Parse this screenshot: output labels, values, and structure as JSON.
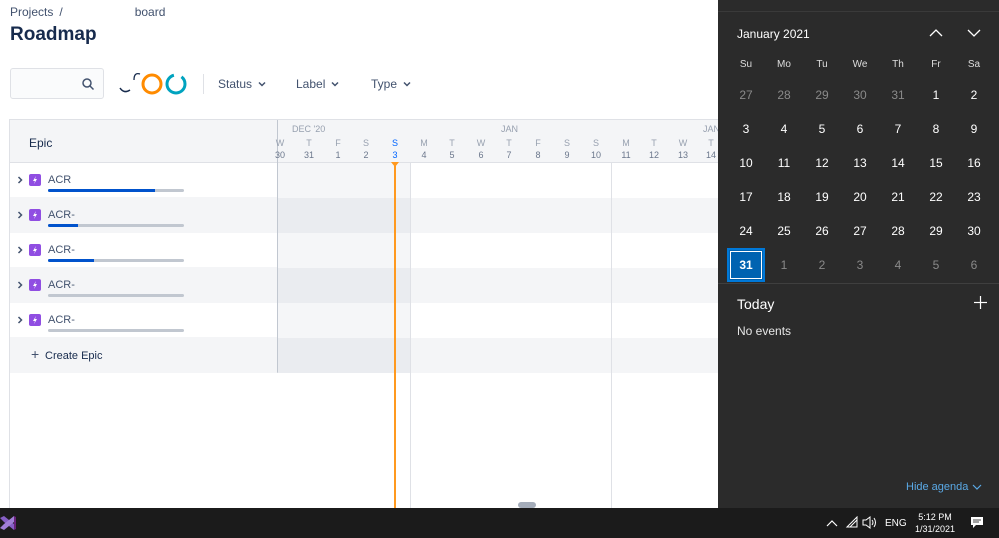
{
  "breadcrumb": {
    "root": "Projects",
    "separator": "/",
    "board": "board"
  },
  "page": {
    "title": "Roadmap"
  },
  "filters": {
    "status": "Status",
    "label": "Label",
    "type": "Type"
  },
  "search": {
    "placeholder": ""
  },
  "epics": {
    "header": "Epic",
    "items": [
      {
        "key": "ACR",
        "progress": 0.79
      },
      {
        "key": "ACR-",
        "progress": 0.22
      },
      {
        "key": "ACR-",
        "progress": 0.34
      },
      {
        "key": "ACR-",
        "progress": 0.0
      },
      {
        "key": "ACR-",
        "progress": 0.0
      }
    ],
    "create_label": "Create Epic"
  },
  "timeline": {
    "months": [
      "DEC '20",
      "JAN",
      "JAN"
    ],
    "day_letters": [
      "W",
      "T",
      "F",
      "S",
      "S",
      "M",
      "T",
      "W",
      "T",
      "F",
      "S",
      "S",
      "M",
      "T",
      "W",
      "T"
    ],
    "day_numbers": [
      "30",
      "31",
      "1",
      "2",
      "3",
      "4",
      "5",
      "6",
      "7",
      "8",
      "9",
      "10",
      "11",
      "12",
      "13",
      "14"
    ]
  },
  "calendar": {
    "title": "January 2021",
    "weekdays": [
      "Su",
      "Mo",
      "Tu",
      "We",
      "Th",
      "Fr",
      "Sa"
    ],
    "weeks": [
      [
        "27",
        "28",
        "29",
        "30",
        "31",
        "1",
        "2"
      ],
      [
        "3",
        "4",
        "5",
        "6",
        "7",
        "8",
        "9"
      ],
      [
        "10",
        "11",
        "12",
        "13",
        "14",
        "15",
        "16"
      ],
      [
        "17",
        "18",
        "19",
        "20",
        "21",
        "22",
        "23"
      ],
      [
        "24",
        "25",
        "26",
        "27",
        "28",
        "29",
        "30"
      ],
      [
        "31",
        "1",
        "2",
        "3",
        "4",
        "5",
        "6"
      ]
    ],
    "selected": "31",
    "agenda_title": "Today",
    "no_events": "No events",
    "hide_agenda": "Hide agenda"
  },
  "taskbar": {
    "language": "ENG",
    "time": "5:12 PM",
    "date": "1/31/2021"
  },
  "colors": {
    "accent": "#0078d7",
    "today_line": "#ff991f",
    "progress": "#0052cc",
    "epic": "#904ee2"
  }
}
